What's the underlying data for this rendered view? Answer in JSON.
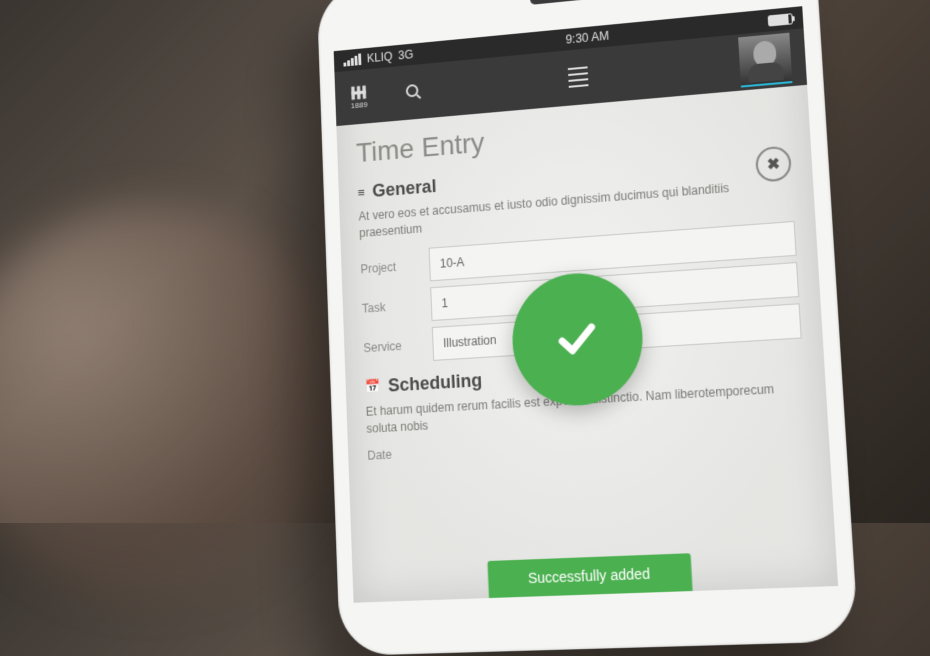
{
  "status_bar": {
    "carrier": "KLIQ",
    "network": "3G",
    "time": "9:30 AM"
  },
  "toolbar": {
    "logo_sub": "1889"
  },
  "page": {
    "title": "Time Entry"
  },
  "sections": {
    "general": {
      "title": "General",
      "desc": "At vero eos et accusamus et iusto odio dignissim ducimus qui blanditiis praesentium",
      "fields": {
        "project": {
          "label": "Project",
          "value": "10-A"
        },
        "task": {
          "label": "Task",
          "value": "1"
        },
        "service": {
          "label": "Service",
          "value": "Illustration"
        }
      }
    },
    "scheduling": {
      "title": "Scheduling",
      "desc": "Et harum quidem rerum facilis est expedita distinctio. Nam liberotemporecum soluta nobis",
      "fields": {
        "date": {
          "label": "Date"
        }
      }
    }
  },
  "toast": {
    "text": "Successfully added"
  }
}
